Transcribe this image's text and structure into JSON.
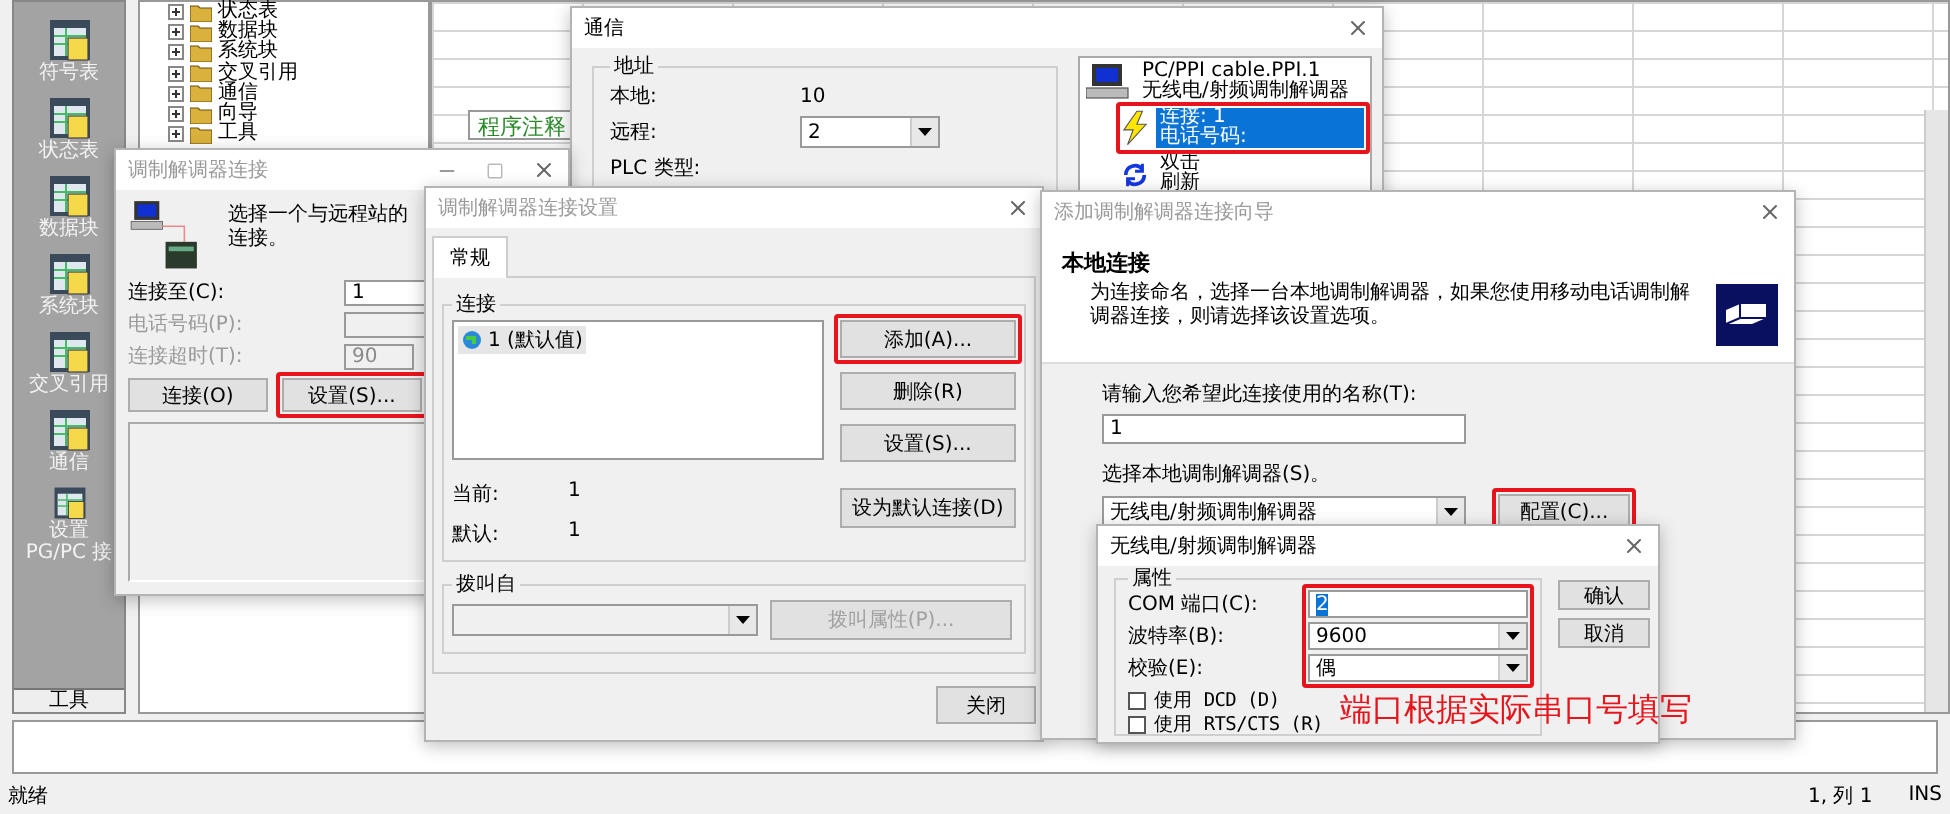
{
  "main_window": {
    "sidebar": [
      {
        "label": "符号表"
      },
      {
        "label": "状态表"
      },
      {
        "label": "数据块"
      },
      {
        "label": "系统块"
      },
      {
        "label": "交叉引用"
      },
      {
        "label": "通信"
      },
      {
        "label": "设置 PG/PC 接"
      }
    ],
    "sidebar_footer": "工具",
    "tree": [
      {
        "label": "状态表"
      },
      {
        "label": "数据块"
      },
      {
        "label": "系统块"
      },
      {
        "label": "交叉引用"
      },
      {
        "label": "通信"
      },
      {
        "label": "向导"
      },
      {
        "label": "工具"
      }
    ],
    "editor": {
      "comment_label": "程序注释"
    },
    "status_bar": {
      "message": "就绪",
      "position": "1, 列 1",
      "mode": "INS"
    }
  },
  "communications_dialog": {
    "title": "通信",
    "active": true,
    "group": "地址",
    "local_label": "本地:",
    "local_value": "10",
    "remote_label": "远程:",
    "remote_value": "2",
    "plc_type_label": "PLC 类型:",
    "device": {
      "lines": [
        "PC/PPI cable.PPI.1",
        "无线电/射频调制解调器"
      ]
    },
    "nodes": [
      {
        "kind": "connection",
        "lines": [
          "连接: 1",
          "电话号码:"
        ],
        "selected": true
      },
      {
        "kind": "refresh",
        "lines": [
          "双击",
          "刷新"
        ],
        "selected": false
      }
    ]
  },
  "modem_connection_dialog": {
    "title": "调制解调器连接",
    "active": false,
    "prompt": "选择一个与远程站的连接。",
    "fields": [
      {
        "label": "连接至(C):",
        "value": "1",
        "disabled": false
      },
      {
        "label": "电话号码(P):",
        "disabled": true
      },
      {
        "label": "连接超时(T):",
        "value": "90",
        "disabled": true
      }
    ],
    "buttons": [
      "连接(O)",
      "设置(S)..."
    ]
  },
  "connection_settings_dialog": {
    "title": "调制解调器连接设置",
    "active": false,
    "tabs": [
      {
        "label": "常规",
        "selected": true
      }
    ],
    "group": "连接",
    "connections": [
      {
        "label": "1 (默认值)",
        "selected": true
      }
    ],
    "current_label": "当前:",
    "current_value": "1",
    "default_label": "默认:",
    "default_value": "1",
    "buttons": [
      "添加(A)...",
      "删除(R)",
      "设置(S)...",
      "设为默认连接(D)"
    ],
    "dial_group": "拨叫自",
    "dial_dropdown": {
      "disabled": true
    },
    "dial_button": {
      "label": "拨叫属性(P)...",
      "disabled": true
    },
    "close_button": "关闭"
  },
  "wizard_dialog": {
    "title": "添加调制解调器连接向导",
    "active": false,
    "heading": "本地连接",
    "description": "为连接命名，选择一台本地调制解调器，如果您使用移动电话调制解调器连接，则请选择该设置选项。",
    "name_label": "请输入您希望此连接使用的名称(T):",
    "name_value": "1",
    "modem_label": "选择本地调制解调器(S)。",
    "modem_value": "无线电/射频调制解调器",
    "configure_button": "配置(C)..."
  },
  "radio_modem_dialog": {
    "title": "无线电/射频调制解调器",
    "active": true,
    "group": "属性",
    "fields": [
      {
        "kind": "text",
        "label": "COM 端口(C):",
        "value": "2"
      },
      {
        "kind": "dropdown",
        "label": "波特率(B):",
        "value": "9600"
      },
      {
        "kind": "dropdown",
        "label": "校验(E):",
        "value": "偶"
      }
    ],
    "options": [
      {
        "label": "使用 DCD (D)",
        "checked": false
      },
      {
        "label": "使用 RTS/CTS (R)",
        "checked": false
      }
    ],
    "buttons": [
      "确认",
      "取消"
    ]
  },
  "annotation": {
    "note": "端口根据实际串口号填写"
  }
}
